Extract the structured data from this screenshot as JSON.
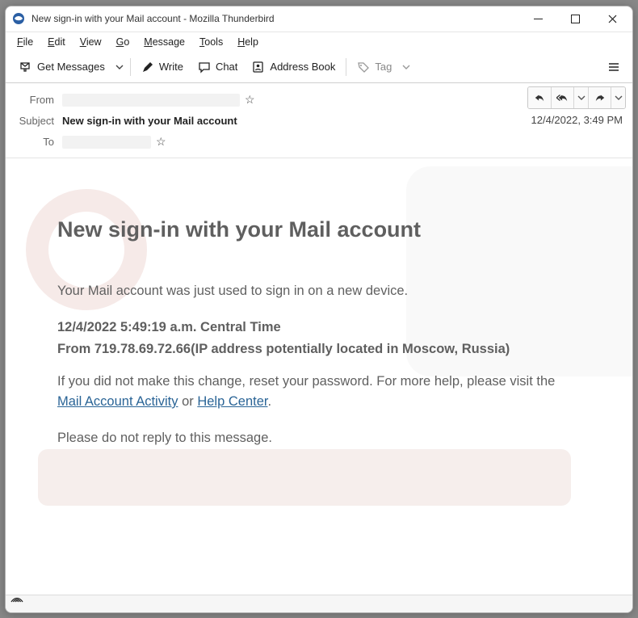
{
  "window": {
    "title": "New sign-in with your Mail account - Mozilla Thunderbird"
  },
  "menu": {
    "file": "File",
    "edit": "Edit",
    "view": "View",
    "go": "Go",
    "message": "Message",
    "tools": "Tools",
    "help": "Help"
  },
  "toolbar": {
    "get_messages": "Get Messages",
    "write": "Write",
    "chat": "Chat",
    "address_book": "Address Book",
    "tag": "Tag"
  },
  "header": {
    "from_label": "From",
    "subject_label": "Subject",
    "to_label": "To",
    "subject": "New sign-in with your Mail account",
    "date": "12/4/2022, 3:49 PM"
  },
  "body": {
    "heading": "New sign-in with your Mail account",
    "intro": "Your Mail account was just used to sign in on a new device.",
    "meta_time": "12/4/2022 5:49:19 a.m. Central Time",
    "meta_from": "From 719.78.69.72.66(IP address potentially located in Moscow, Russia)",
    "line1a": "If you did not make this change, ",
    "reset_link": "reset your password",
    "line1b": ". For more help, please visit the ",
    "activity_link": "Mail Account Activity",
    "or": " or ",
    "help_link": "Help Center",
    "period": ".",
    "donot": "Please do not reply to this message."
  }
}
